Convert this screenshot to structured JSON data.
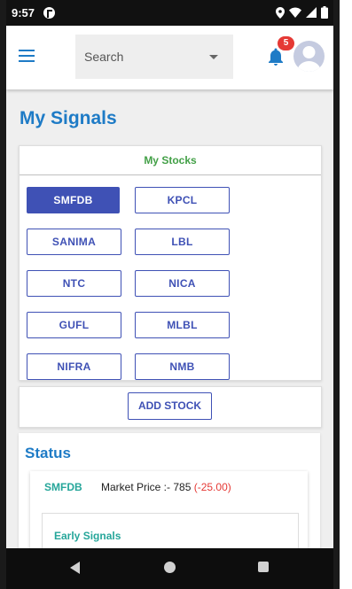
{
  "status_bar": {
    "time": "9:57"
  },
  "app_bar": {
    "search_placeholder": "Search",
    "notification_count": "5"
  },
  "page": {
    "title": "My Signals"
  },
  "stocks": {
    "header": "My Stocks",
    "items": [
      "SMFDB",
      "KPCL",
      "SANIMA",
      "LBL",
      "NTC",
      "NICA",
      "GUFL",
      "MLBL",
      "NIFRA",
      "NMB"
    ],
    "selected": "SMFDB"
  },
  "add_stock": {
    "label": "ADD STOCK"
  },
  "status_section": {
    "title": "Status",
    "symbol": "SMFDB",
    "market_price_label": "Market Price :- 785",
    "change": "(-25.00)",
    "early_signals_label": "Early Signals"
  },
  "colors": {
    "primary_blue": "#1e7bc6",
    "indigo": "#3f51b5",
    "green": "#43a047",
    "teal": "#26a69a",
    "red": "#e53935"
  }
}
